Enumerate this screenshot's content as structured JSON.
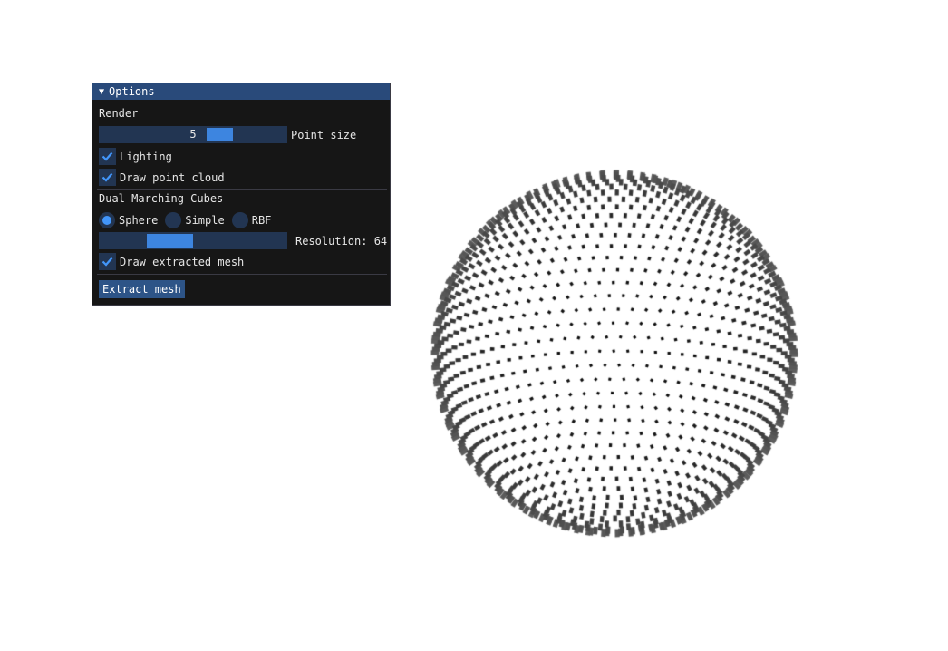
{
  "window": {
    "title": "Options",
    "collapse_icon": "triangle-down-icon"
  },
  "render": {
    "section_label": "Render",
    "point_size": {
      "value": "5",
      "label": "Point size",
      "fraction": 0.57
    },
    "lighting": {
      "label": "Lighting",
      "checked": true
    },
    "draw_point_cloud": {
      "label": "Draw point cloud",
      "checked": true
    }
  },
  "dual_marching_cubes": {
    "section_label": "Dual Marching Cubes",
    "shape_options": [
      {
        "label": "Sphere",
        "selected": true
      },
      {
        "label": "Simple",
        "selected": false
      },
      {
        "label": "RBF",
        "selected": false
      }
    ],
    "resolution": {
      "label": "Resolution: 64",
      "fraction": 0.25
    },
    "draw_extracted_mesh": {
      "label": "Draw extracted mesh",
      "checked": true
    },
    "extract_button": "Extract mesh"
  },
  "colors": {
    "accent": "#4296fa",
    "title_bar": "#294a7a",
    "frame_bg": "#223552",
    "button": "#2d5487",
    "panel_bg": "#161616"
  }
}
